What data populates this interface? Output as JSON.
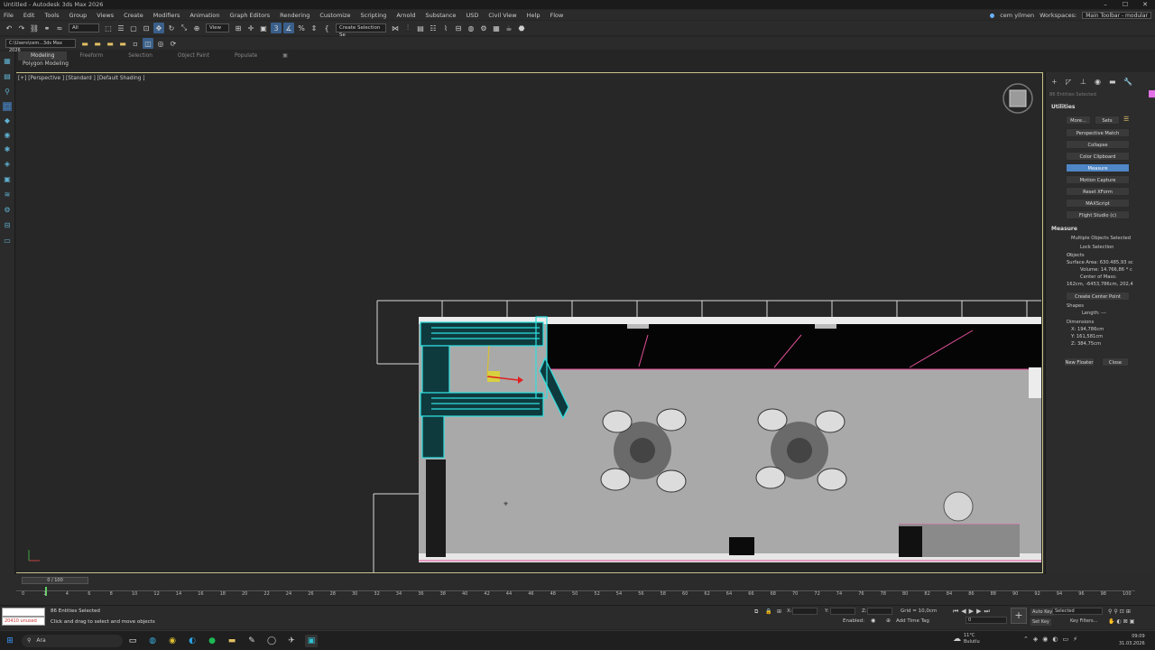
{
  "window": {
    "title": "Untitled - Autodesk 3ds Max 2026",
    "min": "–",
    "max": "☐",
    "close": "✕"
  },
  "menu": [
    "File",
    "Edit",
    "Tools",
    "Group",
    "Views",
    "Create",
    "Modifiers",
    "Animation",
    "Graph Editors",
    "Rendering",
    "Customize",
    "Scripting",
    "Arnold",
    "Substance",
    "USD",
    "Civil View",
    "Help",
    "Flow"
  ],
  "menu_right": {
    "user": "cem yilmen",
    "workspaces_label": "Workspaces:",
    "workspace": "Main Toolbar - modular"
  },
  "toolbar": {
    "filter": "All",
    "view": "View",
    "selection_set": "Create Selection Se"
  },
  "toolbar2": {
    "path": "C:\\Users\\cem...3ds Max 2026"
  },
  "ribbon": {
    "tabs": [
      "Modeling",
      "Freeform",
      "Selection",
      "Object Paint",
      "Populate"
    ],
    "active_tab": "Modeling",
    "panel": "Polygon Modeling"
  },
  "viewport": {
    "label": "[+] [Perspective ] [Standard ] [Default Shading ]"
  },
  "command_panel": {
    "selection_status": "86 Entities Selected",
    "utilities_title": "Utilities",
    "more_button": "More...",
    "sets_button": "Sets",
    "utilities": [
      "Perspective Match",
      "Collapse",
      "Color Clipboard",
      "Measure",
      "Motion Capture",
      "Reset XForm",
      "MAXScript",
      "Flight Studio (c)"
    ],
    "selected_utility": "Measure",
    "measure": {
      "title": "Measure",
      "status": "Multiple Objects Selected",
      "lock_selection": "Lock Selection",
      "objects_label": "Objects",
      "surface_area": "Surface Area: 630.485,93 sc",
      "volume": "Volume: 14.766,86 * c",
      "center_of_mass_label": "Center of Mass:",
      "center_of_mass": "162cm, -6453,786cm, 202,4",
      "create_center_point": "Create Center Point",
      "shapes_label": "Shapes",
      "length": "Length: ---",
      "dimensions_label": "Dimensions",
      "dim_x": "X: 194,786cm",
      "dim_y": "Y: 161,581cm",
      "dim_z": "Z: 384,75cm",
      "new_floater": "New Floater",
      "close": "Close"
    }
  },
  "timeline": {
    "frame": "0 / 100",
    "ticks": [
      "0",
      "2",
      "4",
      "6",
      "8",
      "10",
      "12",
      "14",
      "16",
      "18",
      "20",
      "22",
      "24",
      "26",
      "28",
      "30",
      "32",
      "34",
      "36",
      "38",
      "40",
      "42",
      "44",
      "46",
      "48",
      "50",
      "52",
      "54",
      "56",
      "58",
      "60",
      "62",
      "64",
      "66",
      "68",
      "70",
      "72",
      "74",
      "76",
      "78",
      "80",
      "82",
      "84",
      "86",
      "88",
      "90",
      "92",
      "94",
      "96",
      "98",
      "100"
    ]
  },
  "status": {
    "maxscript": "20410 unused",
    "selected": "86 Entities Selected",
    "prompt": "Click and drag to select and move objects",
    "x_label": "X:",
    "y_label": "Y:",
    "z_label": "Z:",
    "grid": "Grid = 10,0cm",
    "enabled": "Enabled:",
    "add_time_tag": "Add Time Tag",
    "auto_key": "Auto Key",
    "set_key": "Set Key",
    "selected_dd": "Selected",
    "key_filters": "Key Filters..."
  },
  "taskbar": {
    "search": "Ara",
    "weather": "11°C",
    "weather_desc": "Bulutlu",
    "time": "09:09",
    "date": "31.03.2026"
  },
  "colors": {
    "selection": "#2fe0e0",
    "accent": "#4f86c6",
    "viewport_border": "#c9c48b"
  }
}
